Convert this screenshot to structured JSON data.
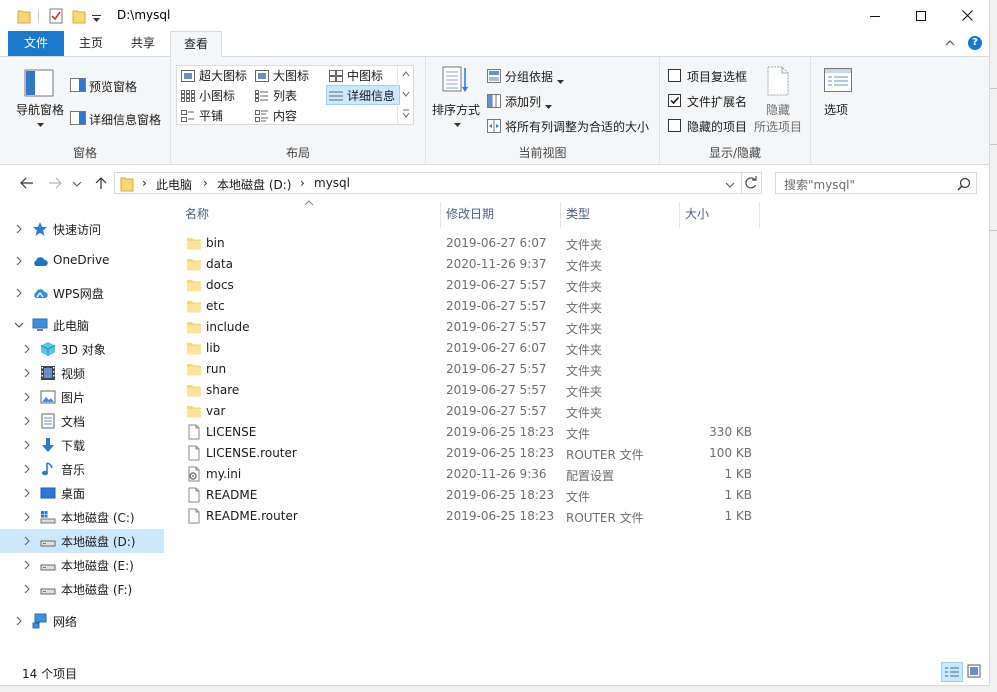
{
  "window": {
    "title": "D:\\mysql"
  },
  "ribbon_tabs": [
    {
      "label": "文件"
    },
    {
      "label": "主页"
    },
    {
      "label": "共享"
    },
    {
      "label": "查看"
    }
  ],
  "ribbon": {
    "panes": {
      "label": "窗格",
      "nav_pane": "导航窗格",
      "preview_pane": "预览窗格",
      "details_pane": "详细信息窗格"
    },
    "layout": {
      "label": "布局",
      "items": [
        "超大图标",
        "大图标",
        "中图标",
        "小图标",
        "列表",
        "详细信息",
        "平铺",
        "内容"
      ],
      "selected": "详细信息"
    },
    "current_view": {
      "label": "当前视图",
      "sort_by": "排序方式",
      "group_by": "分组依据",
      "add_column": "添加列",
      "fit_columns": "将所有列调整为合适的大小"
    },
    "show_hide": {
      "label": "显示/隐藏",
      "item_checkboxes": "项目复选框",
      "file_extensions": "文件扩展名",
      "hidden_items": "隐藏的项目",
      "hide_selected_line1": "隐藏",
      "hide_selected_line2": "所选项目",
      "item_checkboxes_checked": false,
      "file_extensions_checked": true,
      "hidden_items_checked": false
    },
    "options": "选项"
  },
  "address": {
    "segments": [
      "此电脑",
      "本地磁盘 (D:)",
      "mysql"
    ],
    "search_placeholder": "搜索\"mysql\""
  },
  "nav": {
    "quick_access": "快速访问",
    "onedrive": "OneDrive",
    "wps": "WPS网盘",
    "this_pc": "此电脑",
    "items": [
      "3D 对象",
      "视频",
      "图片",
      "文档",
      "下载",
      "音乐",
      "桌面",
      "本地磁盘 (C:)",
      "本地磁盘 (D:)",
      "本地磁盘 (E:)",
      "本地磁盘 (F:)"
    ],
    "network": "网络",
    "selected": "本地磁盘 (D:)"
  },
  "columns": {
    "name": "名称",
    "date": "修改日期",
    "type": "类型",
    "size": "大小"
  },
  "files": [
    {
      "name": "bin",
      "date": "2019-06-27 6:07",
      "type": "文件夹",
      "size": "",
      "icon": "folder-icon"
    },
    {
      "name": "data",
      "date": "2020-11-26 9:37",
      "type": "文件夹",
      "size": "",
      "icon": "folder-icon"
    },
    {
      "name": "docs",
      "date": "2019-06-27 5:57",
      "type": "文件夹",
      "size": "",
      "icon": "folder-icon"
    },
    {
      "name": "etc",
      "date": "2019-06-27 5:57",
      "type": "文件夹",
      "size": "",
      "icon": "folder-icon"
    },
    {
      "name": "include",
      "date": "2019-06-27 5:57",
      "type": "文件夹",
      "size": "",
      "icon": "folder-icon"
    },
    {
      "name": "lib",
      "date": "2019-06-27 6:07",
      "type": "文件夹",
      "size": "",
      "icon": "folder-icon"
    },
    {
      "name": "run",
      "date": "2019-06-27 5:57",
      "type": "文件夹",
      "size": "",
      "icon": "folder-icon"
    },
    {
      "name": "share",
      "date": "2019-06-27 5:57",
      "type": "文件夹",
      "size": "",
      "icon": "folder-icon"
    },
    {
      "name": "var",
      "date": "2019-06-27 5:57",
      "type": "文件夹",
      "size": "",
      "icon": "folder-icon"
    },
    {
      "name": "LICENSE",
      "date": "2019-06-25 18:23",
      "type": "文件",
      "size": "330 KB",
      "icon": "file-icon"
    },
    {
      "name": "LICENSE.router",
      "date": "2019-06-25 18:23",
      "type": "ROUTER 文件",
      "size": "100 KB",
      "icon": "file-icon"
    },
    {
      "name": "my.ini",
      "date": "2020-11-26 9:36",
      "type": "配置设置",
      "size": "1 KB",
      "icon": "settings-file-icon"
    },
    {
      "name": "README",
      "date": "2019-06-25 18:23",
      "type": "文件",
      "size": "1 KB",
      "icon": "file-icon"
    },
    {
      "name": "README.router",
      "date": "2019-06-25 18:23",
      "type": "ROUTER 文件",
      "size": "1 KB",
      "icon": "file-icon"
    }
  ],
  "status": {
    "item_count": "14 个项目"
  },
  "colors": {
    "accent": "#1979ca",
    "folder": "#f8d775",
    "selection": "#cce8ff"
  }
}
